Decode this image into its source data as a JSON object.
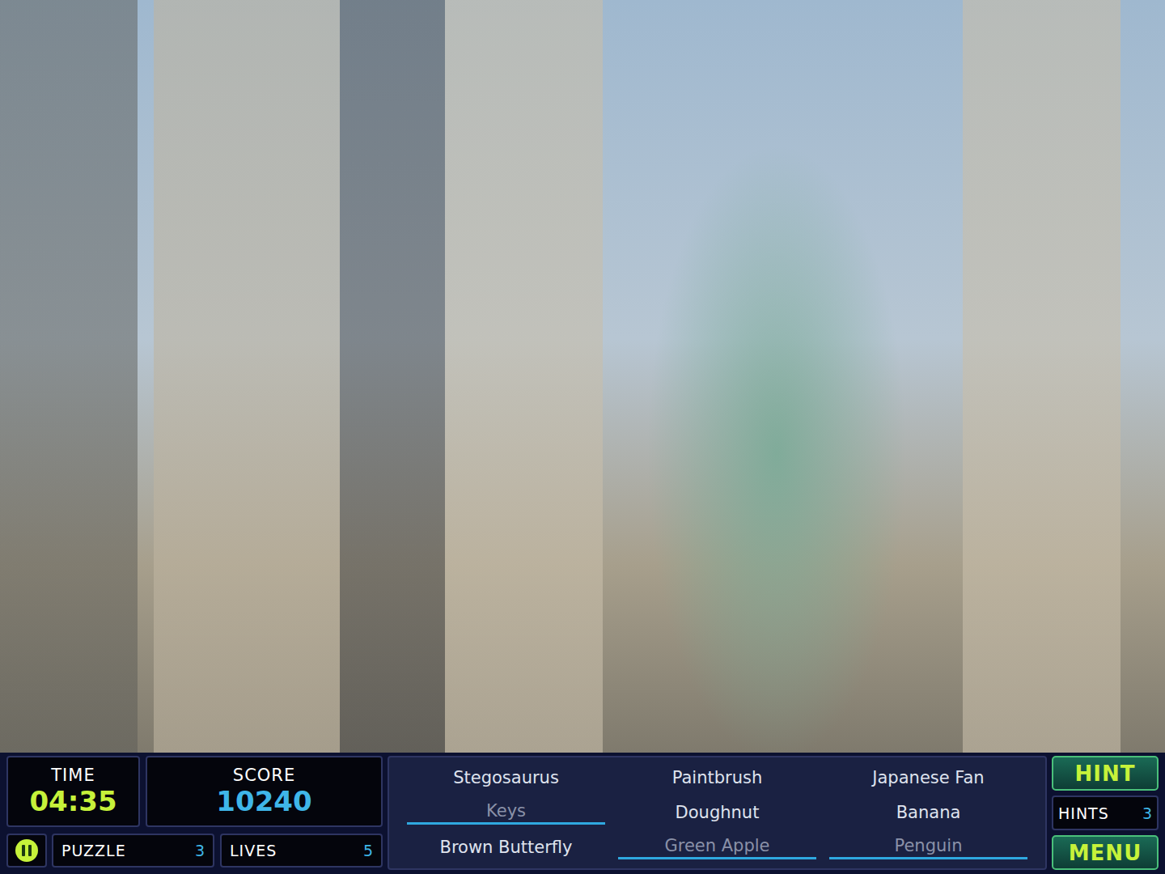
{
  "scene": {
    "kind": "photo"
  },
  "time": {
    "label": "TIME",
    "value": "04:35"
  },
  "score": {
    "label": "SCORE",
    "value": "10240"
  },
  "puzzle": {
    "label": "PUZZLE",
    "value": "3"
  },
  "lives": {
    "label": "LIVES",
    "value": "5"
  },
  "items": [
    {
      "name": "Stegosaurus",
      "found": false
    },
    {
      "name": "Paintbrush",
      "found": false
    },
    {
      "name": "Japanese Fan",
      "found": false
    },
    {
      "name": "Keys",
      "found": true
    },
    {
      "name": "Doughnut",
      "found": false
    },
    {
      "name": "Banana",
      "found": false
    },
    {
      "name": "Brown Butterfly",
      "found": false
    },
    {
      "name": "Green Apple",
      "found": true
    },
    {
      "name": "Penguin",
      "found": true
    }
  ],
  "hint_button": "HINT",
  "hints": {
    "label": "HINTS",
    "value": "3"
  },
  "menu_button": "MENU"
}
